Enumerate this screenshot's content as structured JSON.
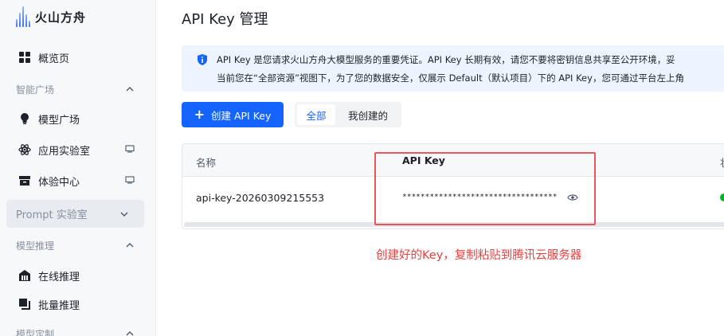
{
  "sidebar": {
    "logo_text": "火山方舟",
    "overview": "概览页",
    "group_square": "智能广场",
    "model_square": "模型广场",
    "app_lab": "应用实验室",
    "experience": "体验中心",
    "prompt_lab": "Prompt 实验室",
    "group_inference": "模型推理",
    "online_inference": "在线推理",
    "batch_inference": "批量推理",
    "group_custom": "模型定制"
  },
  "main": {
    "title": "API Key 管理",
    "notice": {
      "line1": "API Key 是您请求火山方舟大模型服务的重要凭证。API Key 长期有效，请您不要将密钥信息共享至公开环境，妥",
      "line2": "当前您在“全部资源”视图下，为了您的数据安全，仅展示 Default（默认项目）下的 API Key，您可通过平台左上角"
    },
    "create_button": "创建 API Key",
    "filter": {
      "all": "全部",
      "mine": "我创建的"
    },
    "table": {
      "headers": {
        "name": "名称",
        "key": "API Key",
        "third": "状"
      },
      "rows": [
        {
          "name": "api-key-20260309215553",
          "key": "**********************************"
        }
      ]
    },
    "annotation": "创建好的Key，复制粘贴到腾讯云服务器"
  },
  "colors": {
    "primary": "#1664ff",
    "annotation": "#e8403f",
    "status": "#00b42a"
  }
}
